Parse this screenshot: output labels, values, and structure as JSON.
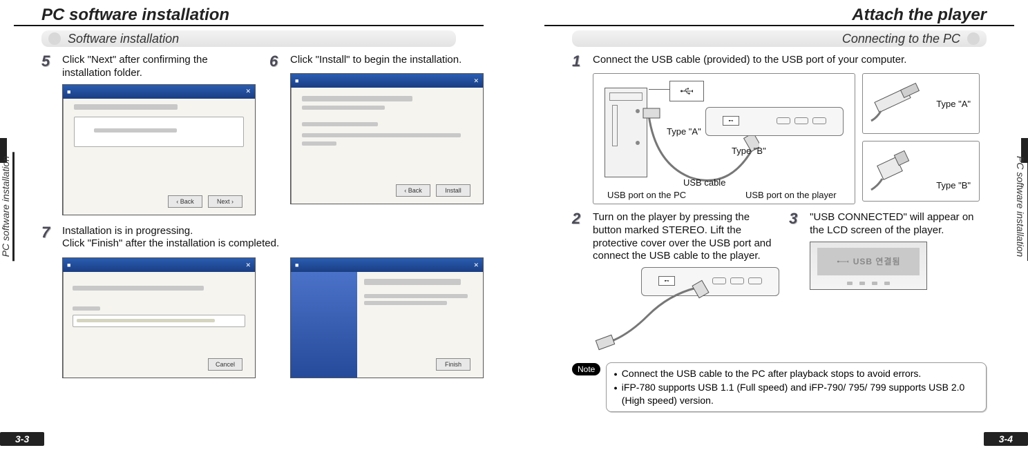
{
  "left": {
    "title": "PC software installation",
    "section": "Software installation",
    "side_label": "PC software installation",
    "page_num": "3-3",
    "steps": {
      "s5": {
        "num": "5",
        "text": "Click \"Next\" after confirming the installation folder."
      },
      "s6": {
        "num": "6",
        "text": "Click \"Install\" to begin the installation."
      },
      "s7": {
        "num": "7",
        "text": "Installation is in progressing.\nClick \"Finish\" after the installation is completed."
      }
    }
  },
  "right": {
    "title": "Attach the player",
    "section": "Connecting to the PC",
    "side_label": "PC software installation",
    "page_num": "3-4",
    "steps": {
      "s1": {
        "num": "1",
        "text": "Connect the USB cable (provided) to the USB port of your computer."
      },
      "s2": {
        "num": "2",
        "text": "Turn on the player by pressing the button marked STEREO. Lift the protective cover over the USB port and connect the USB cable to the player."
      },
      "s3": {
        "num": "3",
        "text": "\"USB CONNECTED\" will appear on the LCD screen of the player."
      }
    },
    "diagram": {
      "type_a": "Type \"A\"",
      "type_b": "Type \"B\"",
      "usb_cable": "USB cable",
      "usb_port_pc": "USB port on the PC",
      "usb_port_player": "USB port on the player",
      "lcd_text": "USB 연결됨"
    },
    "note": {
      "label": "Note",
      "items": [
        "Connect the USB cable to the PC after playback stops to avoid errors.",
        "iFP-780 supports USB 1.1 (Full speed) and iFP-790/ 795/ 799 supports USB 2.0 (High speed) version."
      ]
    }
  }
}
